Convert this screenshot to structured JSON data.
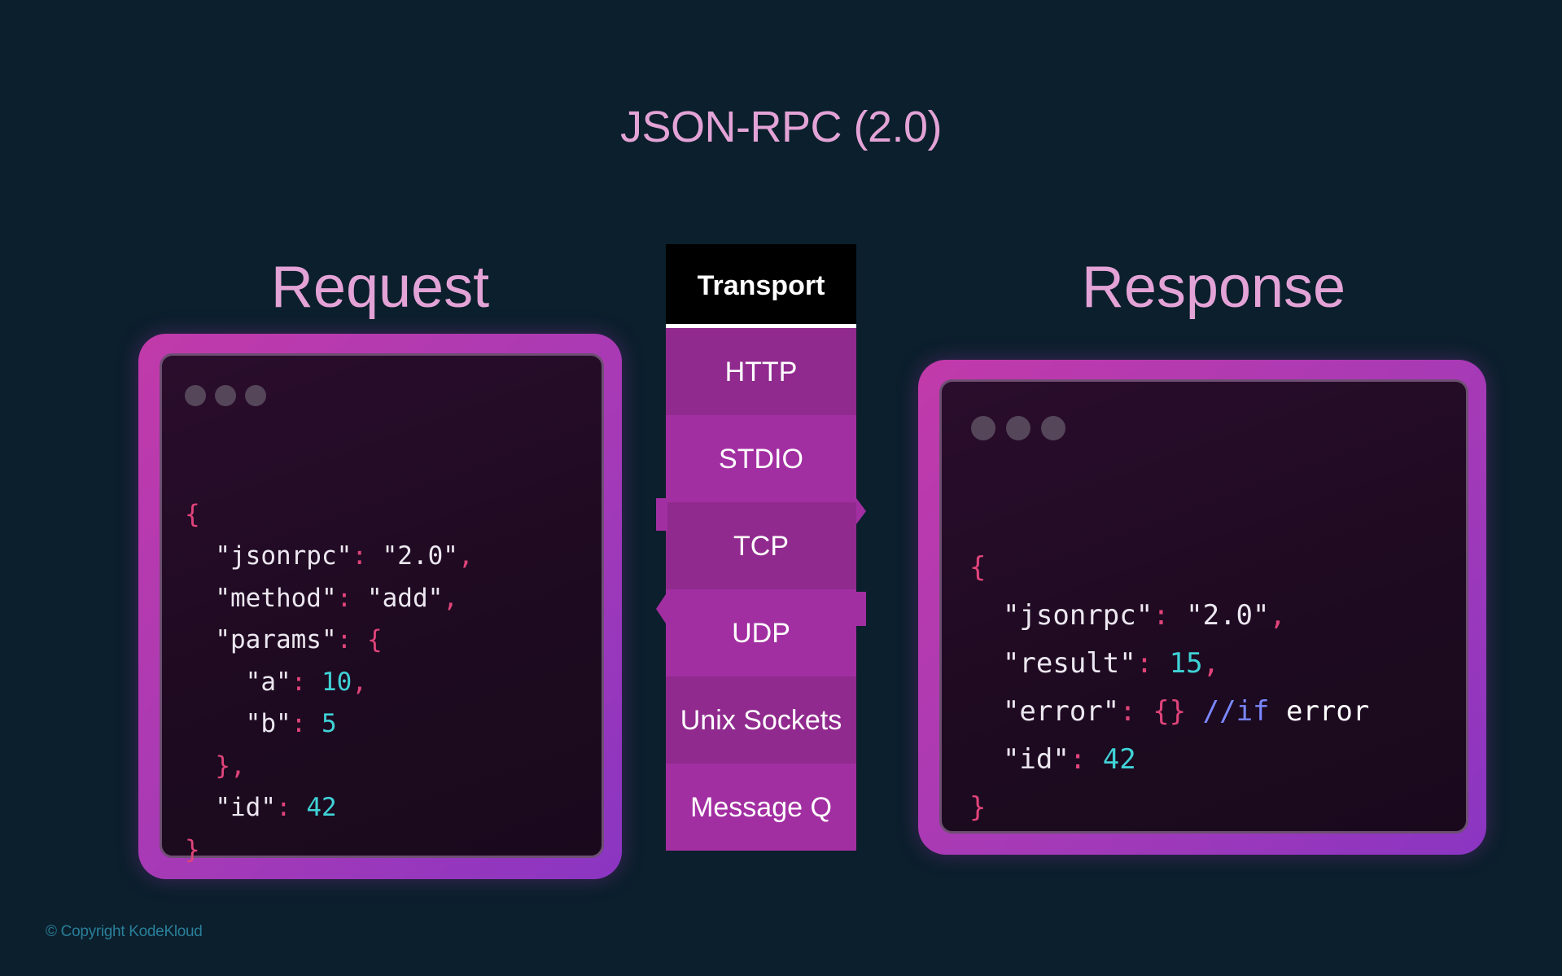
{
  "title": "JSON-RPC (2.0)",
  "request": {
    "heading": "Request",
    "code": {
      "l1_open": "{",
      "l2_key": "\"jsonrpc\"",
      "l2_colon": ": ",
      "l2_val": "\"2.0\"",
      "l2_comma": ",",
      "l3_key": "\"method\"",
      "l3_colon": ": ",
      "l3_val": "\"add\"",
      "l3_comma": ",",
      "l4_key": "\"params\"",
      "l4_colon": ": ",
      "l4_brace": "{",
      "l5_key": "\"a\"",
      "l5_colon": ": ",
      "l5_val": "10",
      "l5_comma": ",",
      "l6_key": "\"b\"",
      "l6_colon": ": ",
      "l6_val": "5",
      "l7_close": "},",
      "l8_key": "\"id\"",
      "l8_colon": ": ",
      "l8_val": "42",
      "l9_close": "}"
    }
  },
  "response": {
    "heading": "Response",
    "code": {
      "l1_open": "{",
      "l2_key": "\"jsonrpc\"",
      "l2_colon": ": ",
      "l2_val": "\"2.0\"",
      "l2_comma": ",",
      "l3_key": "\"result\"",
      "l3_colon": ": ",
      "l3_val": "15",
      "l3_comma": ",",
      "l4_key": "\"error\"",
      "l4_colon": ": ",
      "l4_val": "{}",
      "l4_comment": " //if",
      "l4_word": " error",
      "l5_key": "\"id\"",
      "l5_colon": ": ",
      "l5_val": "42",
      "l6_close": "}"
    }
  },
  "transport": {
    "header": "Transport",
    "items": [
      "HTTP",
      "STDIO",
      "TCP",
      "UDP",
      "Unix Sockets",
      "Message Q"
    ]
  },
  "copyright": "© Copyright KodeKloud",
  "colors": {
    "background": "#0b1f2c",
    "heading": "#e3a3d6",
    "frame": "#a63ab6",
    "punctuation": "#e0447a",
    "number": "#3fd2d6",
    "comment": "#7a87ff"
  }
}
